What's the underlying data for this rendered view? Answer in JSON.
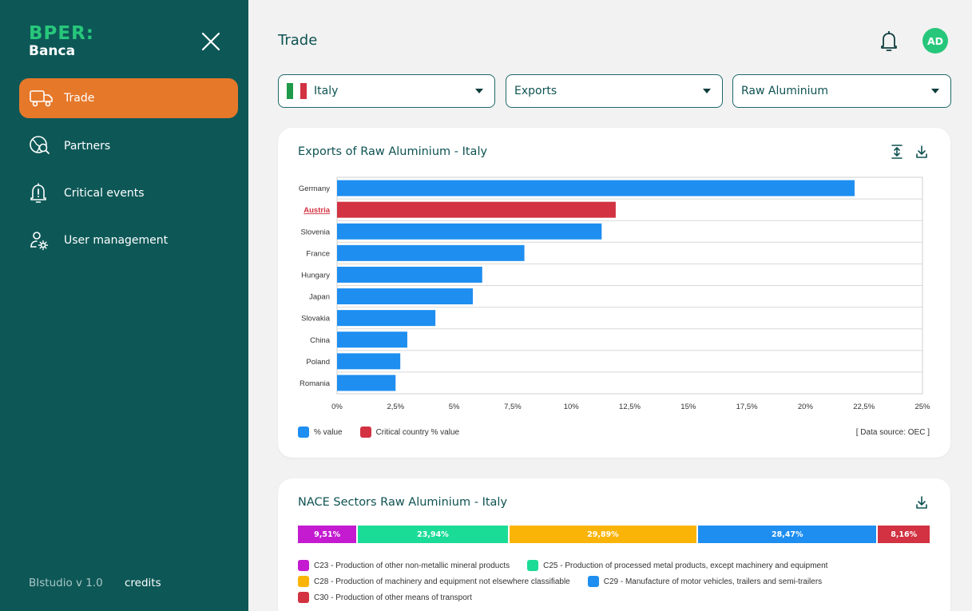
{
  "brand": {
    "line1": "BPER:",
    "line2": "Banca"
  },
  "sidebar": {
    "items": [
      {
        "label": "Trade",
        "icon": "truck-icon",
        "active": true
      },
      {
        "label": "Partners",
        "icon": "globe-search-icon",
        "active": false
      },
      {
        "label": "Critical events",
        "icon": "bell-alert-icon",
        "active": false
      },
      {
        "label": "User management",
        "icon": "user-settings-icon",
        "active": false
      }
    ],
    "version": "BIstudio  v 1.0",
    "credits": "credits"
  },
  "header": {
    "title": "Trade",
    "avatar_initials": "AD"
  },
  "filters": {
    "country": "Italy",
    "flow": "Exports",
    "product": "Raw Aluminium"
  },
  "colors": {
    "accent": "#e6782a",
    "sidebar": "#0d5857",
    "value": "#1e8ef0",
    "critical": "#d23241"
  },
  "card1": {
    "title": "Exports of Raw Aluminium - Italy",
    "legend_value": "% value",
    "legend_critical": "Critical country % value",
    "data_source": "[ Data source: OEC ]"
  },
  "chart_data": {
    "type": "bar",
    "orientation": "horizontal",
    "title": "Exports of Raw Aluminium - Italy",
    "categories": [
      "Germany",
      "Austria",
      "Slovenia",
      "France",
      "Hungary",
      "Japan",
      "Slovakia",
      "China",
      "Poland",
      "Romania"
    ],
    "values": [
      22.1,
      11.9,
      11.3,
      8.0,
      6.2,
      5.8,
      4.2,
      3.0,
      2.7,
      2.5
    ],
    "critical": [
      false,
      true,
      false,
      false,
      false,
      false,
      false,
      false,
      false,
      false
    ],
    "x_ticks": [
      "0%",
      "2,5%",
      "5%",
      "7,5%",
      "10%",
      "12,5%",
      "15%",
      "17,5%",
      "20%",
      "22,5%",
      "25%"
    ],
    "xlim": [
      0,
      25
    ],
    "legend": [
      "% value",
      "Critical country % value"
    ],
    "legend_position": "bottom-left",
    "grid": true
  },
  "card2": {
    "title": "NACE Sectors Raw Aluminium - Italy",
    "segments": [
      {
        "label": "9,51%",
        "value": 9.51,
        "color": "#c41bd1"
      },
      {
        "label": "23,94%",
        "value": 23.94,
        "color": "#1bdc96"
      },
      {
        "label": "29,89%",
        "value": 29.89,
        "color": "#fab408"
      },
      {
        "label": "28,47%",
        "value": 28.47,
        "color": "#1e8ef0"
      },
      {
        "label": "8,16%",
        "value": 8.16,
        "color": "#d23241"
      }
    ],
    "legend": [
      {
        "label": "C23 - Production of other non-metallic mineral products",
        "color": "#c41bd1"
      },
      {
        "label": "C25 - Production of processed metal products, except machinery and equipment",
        "color": "#1bdc96"
      },
      {
        "label": "C28 - Production of machinery and equipment not elsewhere classifiable",
        "color": "#fab408"
      },
      {
        "label": "C29 - Manufacture of motor vehicles, trailers and semi-trailers",
        "color": "#1e8ef0"
      },
      {
        "label": "C30 - Production of other means of transport",
        "color": "#d23241"
      }
    ]
  }
}
